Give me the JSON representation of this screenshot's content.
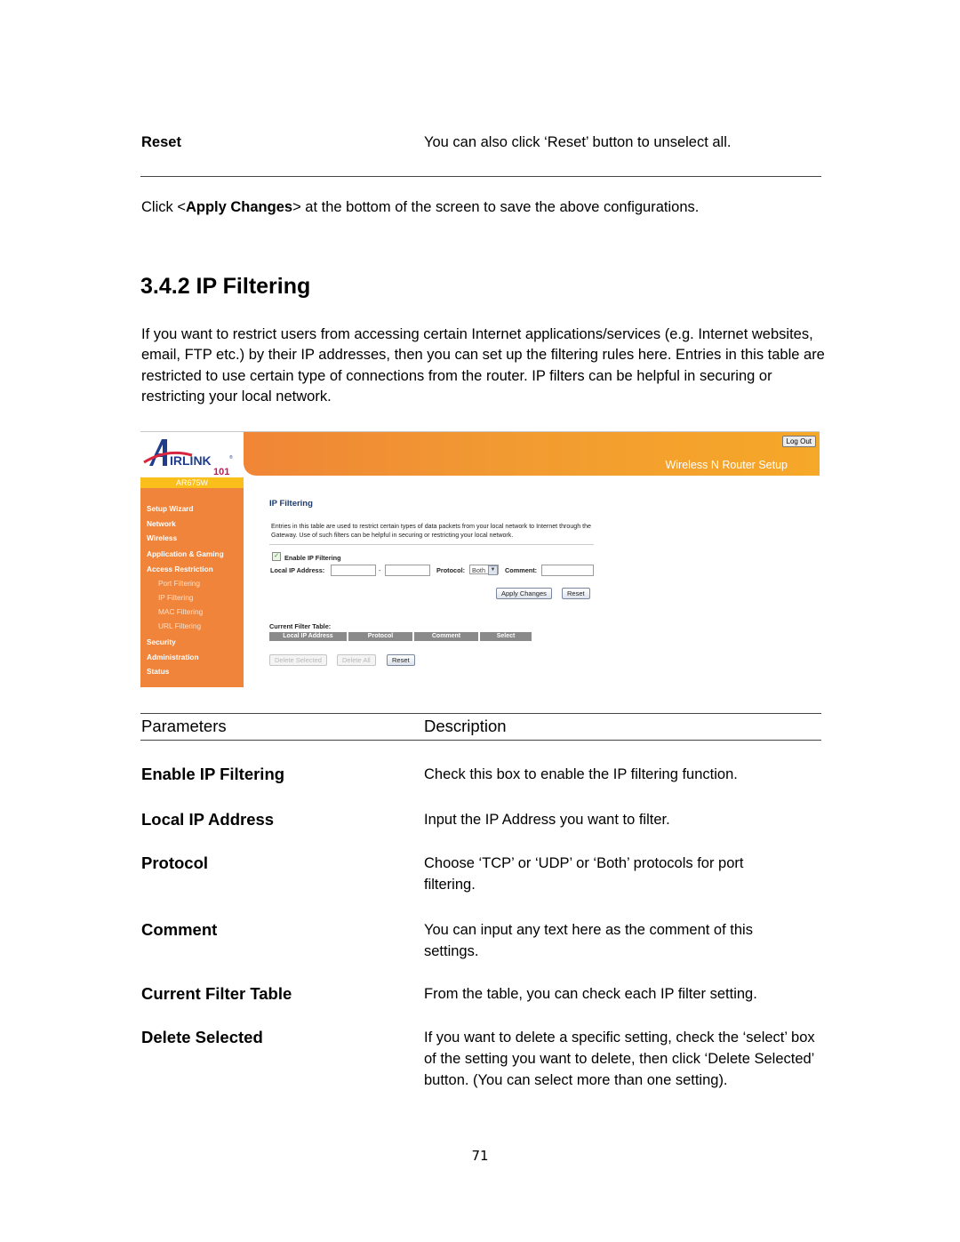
{
  "top_param": {
    "name": "Reset",
    "description": "You can also click ‘Reset’ button to unselect all."
  },
  "apply_note": {
    "prefix": "Click <",
    "bold": "Apply Changes",
    "suffix": "> at the bottom of the screen to save the above configurations."
  },
  "section": {
    "title": "3.4.2 IP Filtering",
    "intro": "If you want to restrict users from accessing certain Internet applications/services (e.g. Internet websites, email, FTP etc.) by their IP addresses, then you can set up the filtering rules here. Entries in this table are restricted to use certain type of connections from the router. IP filters can be helpful in securing or restricting your local network."
  },
  "router_ui": {
    "logo_text": "AIRLINK",
    "logo_number": "101",
    "model": "AR675W",
    "banner_title": "Wireless N Router Setup",
    "logout_label": "Log Out",
    "nav": [
      {
        "label": "Setup Wizard",
        "sub": false
      },
      {
        "label": "Network",
        "sub": false
      },
      {
        "label": "Wireless",
        "sub": false
      },
      {
        "label": "Application & Gaming",
        "sub": false
      },
      {
        "label": "Access Restriction",
        "sub": false
      },
      {
        "label": "Port Filtering",
        "sub": true
      },
      {
        "label": "IP Filtering",
        "sub": true
      },
      {
        "label": "MAC Filtering",
        "sub": true
      },
      {
        "label": "URL Filtering",
        "sub": true
      },
      {
        "label": "Security",
        "sub": false
      },
      {
        "label": "Administration",
        "sub": false
      },
      {
        "label": "Status",
        "sub": false
      }
    ],
    "page_title": "IP Filtering",
    "page_description": "Entries in this table are used to restrict certain types of data packets from your local network to Internet through the Gateway. Use of such filters can be helpful in securing or restricting your local network.",
    "enable_label": "Enable IP Filtering",
    "enable_checked": true,
    "local_ip_label": "Local IP Address:",
    "ip_range_separator": "-",
    "local_ip_start": "",
    "local_ip_end": "",
    "protocol_label": "Protocol:",
    "protocol_value": "Both",
    "comment_label": "Comment:",
    "comment_value": "",
    "apply_label": "Apply Changes",
    "reset_label": "Reset",
    "table_title": "Current Filter Table:",
    "table_headers": [
      "Local IP Address",
      "Protocol",
      "Comment",
      "Select"
    ],
    "delete_selected_label": "Delete Selected",
    "delete_all_label": "Delete All",
    "table_reset_label": "Reset"
  },
  "param_table": {
    "header_param": "Parameters",
    "header_desc": "Description",
    "rows": [
      {
        "name": "Enable IP Filtering",
        "description": "Check this box to enable the IP filtering function."
      },
      {
        "name": "Local IP Address",
        "description": "Input the IP Address you want to filter."
      },
      {
        "name": "Protocol",
        "description": "Choose ‘TCP’ or ‘UDP’ or ‘Both’ protocols for port filtering."
      },
      {
        "name": "Comment",
        "description": "You can input any text here as the comment of this settings."
      },
      {
        "name": "Current Filter Table",
        "description": "From the table, you can check each IP filter setting."
      },
      {
        "name": "Delete Selected",
        "description": "If you want to delete a specific setting, check the ‘select’ box of the setting you want to delete, then click ‘Delete Selected’ button. (You can select more than one setting)."
      }
    ]
  },
  "page_number": "71"
}
